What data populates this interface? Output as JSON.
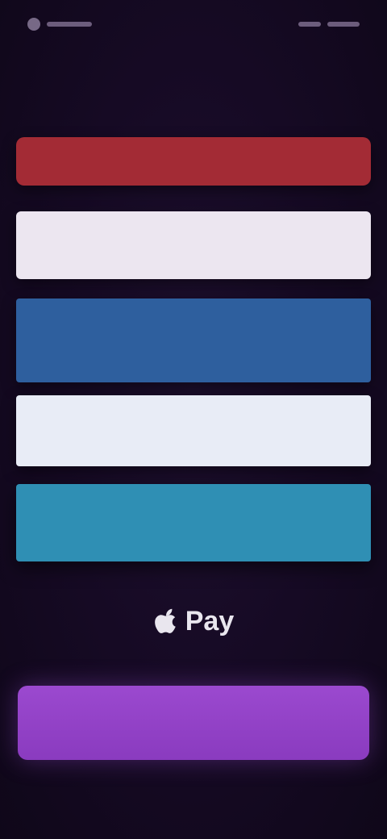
{
  "status_bar": {
    "left_icon": "status-dot-icon",
    "right_icon": "battery-icon"
  },
  "header": {
    "label": "",
    "line1": "",
    "line2": ""
  },
  "stripes": {
    "red_label": "",
    "white1_label": "",
    "blue_label": "",
    "white2_label": "",
    "teal_label": ""
  },
  "apple_pay": {
    "label": "Pay",
    "icon": "apple-icon"
  },
  "purple_button": {
    "label": ""
  }
}
